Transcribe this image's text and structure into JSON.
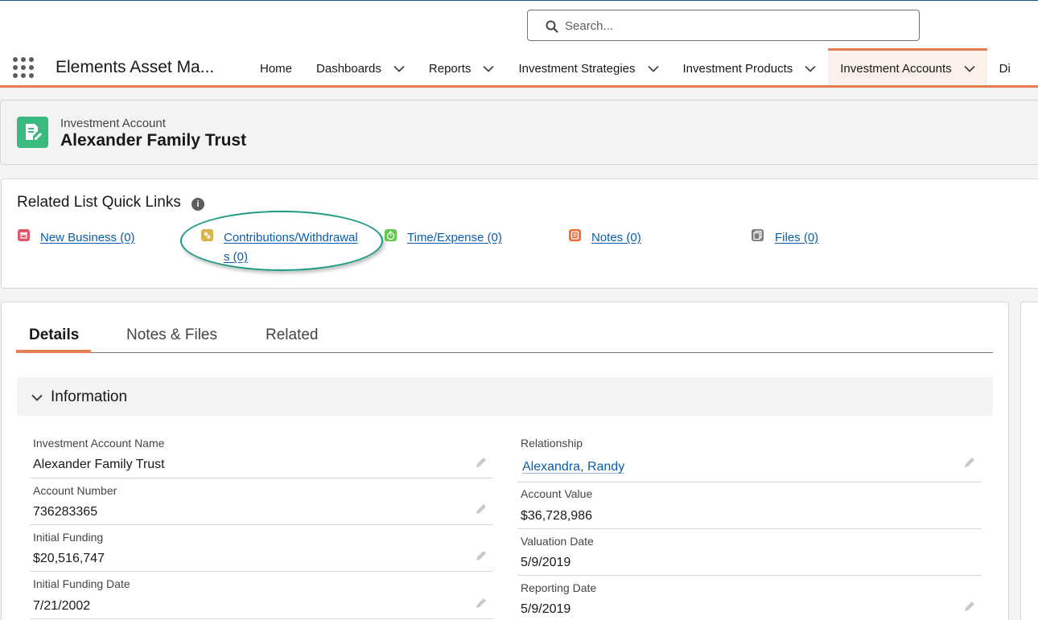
{
  "search": {
    "placeholder": "Search..."
  },
  "app": {
    "name": "Elements Asset Ma..."
  },
  "nav": {
    "items": [
      {
        "label": "Home"
      },
      {
        "label": "Dashboards"
      },
      {
        "label": "Reports"
      },
      {
        "label": "Investment Strategies"
      },
      {
        "label": "Investment Products"
      },
      {
        "label": "Investment Accounts"
      },
      {
        "label": "Di"
      }
    ]
  },
  "record": {
    "object_label": "Investment Account",
    "title": "Alexander Family Trust"
  },
  "quick_links": {
    "title": "Related List Quick Links",
    "info_glyph": "i",
    "links": [
      {
        "label": "New Business (0)",
        "icon": "new-business-icon",
        "color": "#e3566a"
      },
      {
        "label_line1": "Contributions/Withdrawal",
        "label_line2": "s (0)",
        "icon": "contributions-icon",
        "color": "#d9b44a"
      },
      {
        "label": "Time/Expense (0)",
        "icon": "stopwatch-icon",
        "color": "#62c84e"
      },
      {
        "label": "Notes (0)",
        "icon": "note-icon",
        "color": "#f26d36"
      },
      {
        "label": "Files (0)",
        "icon": "files-icon",
        "color": "#7c7c7c"
      }
    ]
  },
  "tabs": [
    {
      "label": "Details"
    },
    {
      "label": "Notes & Files"
    },
    {
      "label": "Related"
    }
  ],
  "section": {
    "title": "Information"
  },
  "fields": {
    "left": [
      {
        "label": "Investment Account Name",
        "value": "Alexander Family Trust"
      },
      {
        "label": "Account Number",
        "value": "736283365"
      },
      {
        "label": "Initial Funding",
        "value": "$20,516,747"
      },
      {
        "label": "Initial Funding Date",
        "value": "7/21/2002"
      }
    ],
    "right": [
      {
        "label": "Relationship",
        "value": "Alexandra, Randy"
      },
      {
        "label": "Account Value",
        "value": "$36,728,986"
      },
      {
        "label": "Valuation Date",
        "value": "5/9/2019"
      },
      {
        "label": "Reporting Date",
        "value": "5/9/2019"
      }
    ]
  },
  "colors": {
    "accent": "#e47f4f",
    "link": "#0b5cab",
    "record_icon": "#3bba7f",
    "highlight_ring": "#1a9a82"
  }
}
